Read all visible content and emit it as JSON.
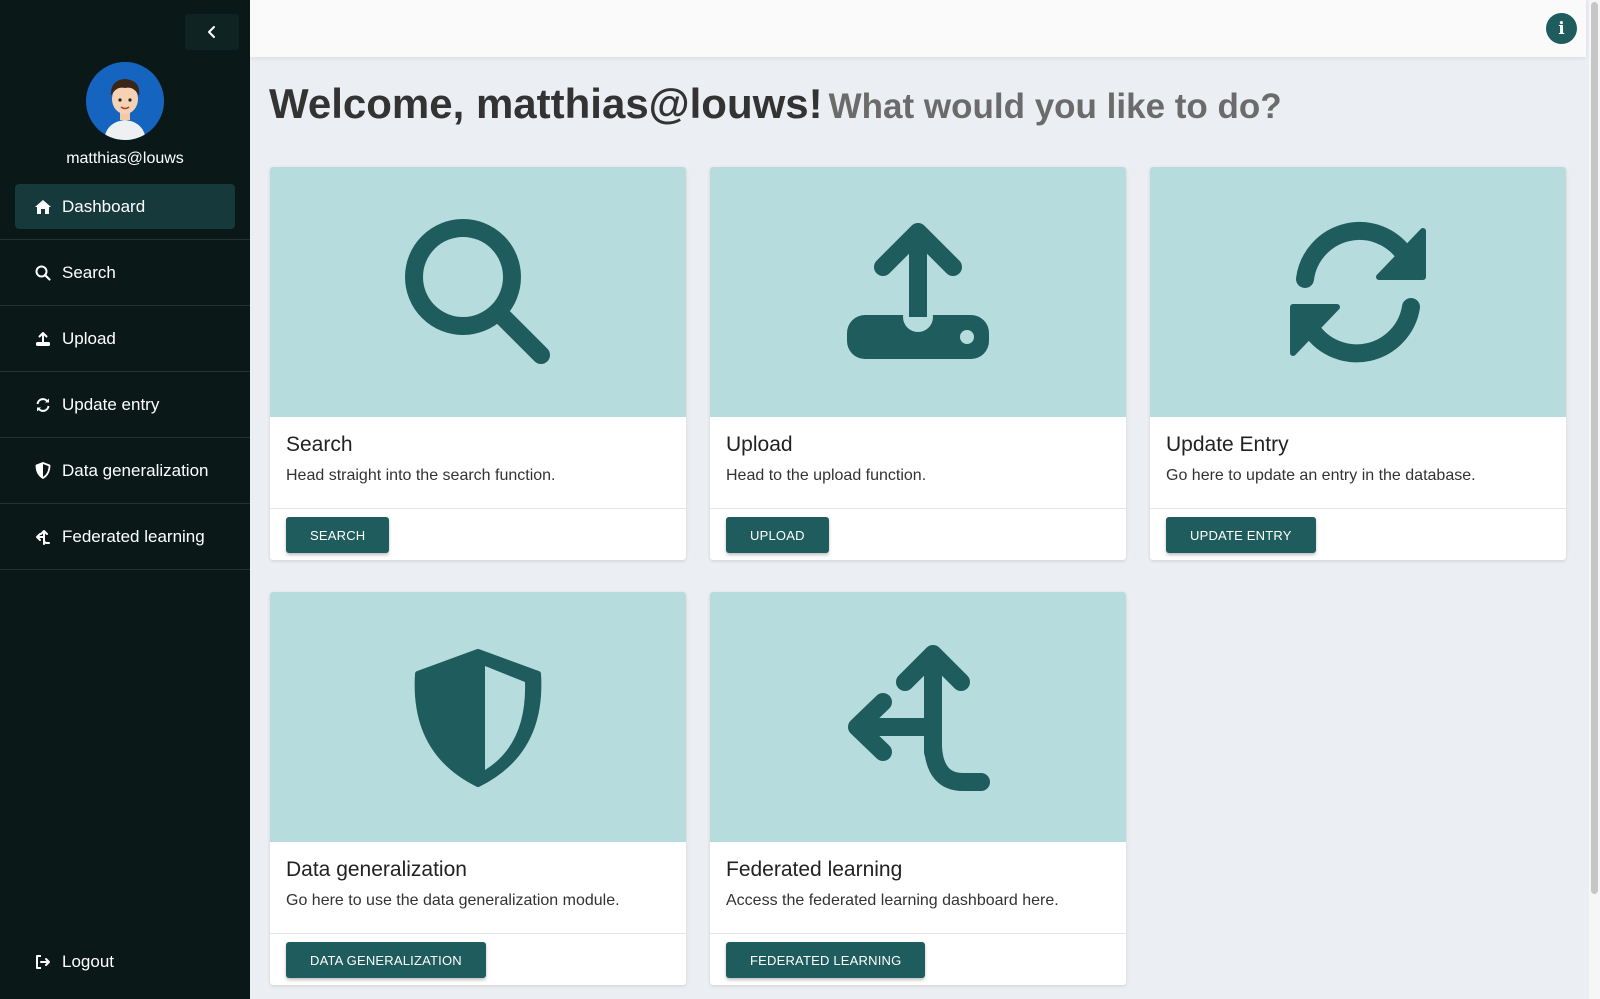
{
  "sidebar": {
    "username": "matthias@louws",
    "items": [
      {
        "label": "Dashboard",
        "icon": "home-icon"
      },
      {
        "label": "Search",
        "icon": "search-icon"
      },
      {
        "label": "Upload",
        "icon": "upload-icon"
      },
      {
        "label": "Update entry",
        "icon": "sync-icon"
      },
      {
        "label": "Data generalization",
        "icon": "shield-icon"
      },
      {
        "label": "Federated learning",
        "icon": "split-arrow-icon"
      }
    ],
    "logout_label": "Logout"
  },
  "header": {
    "welcome": "Welcome, matthias@louws!",
    "subtitle": "What would you like to do?"
  },
  "cards": [
    {
      "title": "Search",
      "description": "Head straight into the search function.",
      "button": "SEARCH",
      "icon": "search-icon"
    },
    {
      "title": "Upload",
      "description": "Head to the upload function.",
      "button": "UPLOAD",
      "icon": "upload-icon"
    },
    {
      "title": "Update Entry",
      "description": "Go here to update an entry in the database.",
      "button": "UPDATE ENTRY",
      "icon": "sync-icon"
    },
    {
      "title": "Data generalization",
      "description": "Go here to use the data generalization module.",
      "button": "DATA GENERALIZATION",
      "icon": "shield-icon"
    },
    {
      "title": "Federated learning",
      "description": "Access the federated learning dashboard here.",
      "button": "FEDERATED LEARNING",
      "icon": "split-arrow-icon"
    }
  ],
  "colors": {
    "sidebar_bg": "#0a1818",
    "accent": "#1f5c5e",
    "card_media_bg": "#b6dcdd",
    "page_bg": "#ebeef2"
  }
}
